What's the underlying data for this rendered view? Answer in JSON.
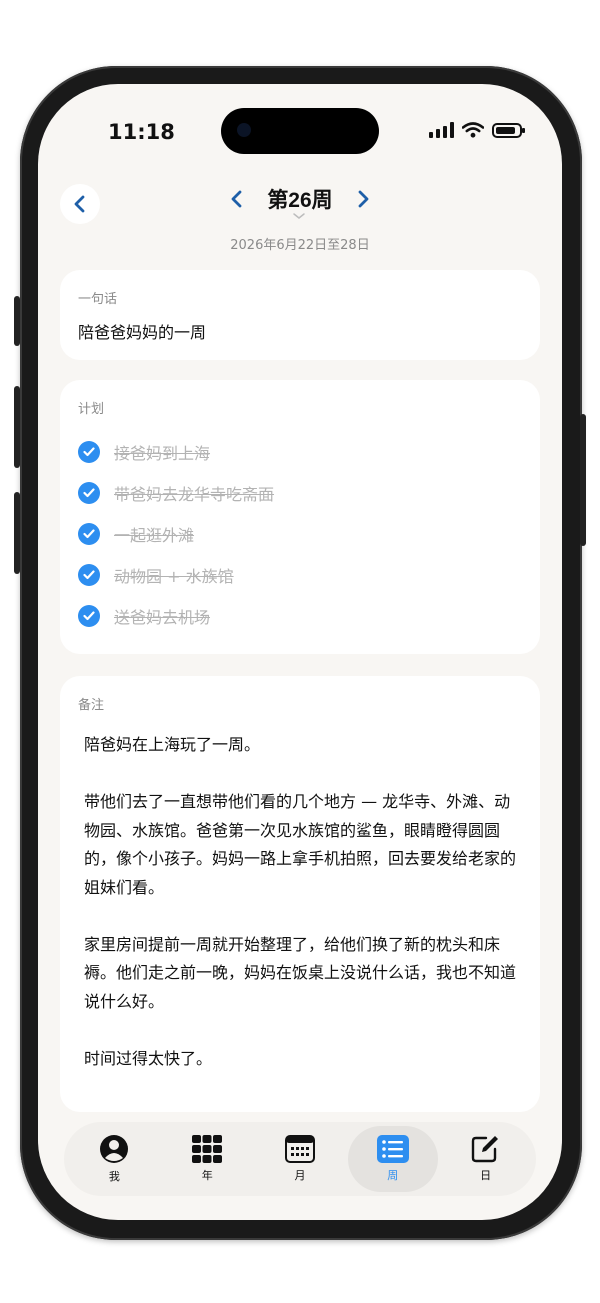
{
  "status": {
    "time": "11:18"
  },
  "header": {
    "week_title": "第26周",
    "date_range": "2026年6月22日至28日"
  },
  "sentence_card": {
    "label": "一句话",
    "text": "陪爸爸妈妈的一周"
  },
  "plan_card": {
    "label": "计划",
    "items": [
      {
        "text": "接爸妈到上海",
        "done": true
      },
      {
        "text": "带爸妈去龙华寺吃斋面",
        "done": true
      },
      {
        "text": "一起逛外滩",
        "done": true
      },
      {
        "text": "动物园 + 水族馆",
        "done": true
      },
      {
        "text": "送爸妈去机场",
        "done": true
      }
    ]
  },
  "notes_card": {
    "label": "备注",
    "paragraphs": [
      "陪爸妈在上海玩了一周。",
      "带他们去了一直想带他们看的几个地方 — 龙华寺、外滩、动物园、水族馆。爸爸第一次见水族馆的鲨鱼，眼睛瞪得圆圆的，像个小孩子。妈妈一路上拿手机拍照，回去要发给老家的姐妹们看。",
      "家里房间提前一周就开始整理了，给他们换了新的枕头和床褥。他们走之前一晚，妈妈在饭桌上没说什么话，我也不知道说什么好。",
      "时间过得太快了。"
    ]
  },
  "tabbar": {
    "tabs": [
      {
        "label": "我",
        "icon": "person-icon"
      },
      {
        "label": "年",
        "icon": "grid-icon"
      },
      {
        "label": "月",
        "icon": "calendar-icon"
      },
      {
        "label": "周",
        "icon": "list-icon",
        "active": true
      },
      {
        "label": "日",
        "icon": "edit-icon"
      }
    ]
  },
  "colors": {
    "accent": "#2d8ef0",
    "nav_blue": "#1e5fa8",
    "background": "#f8f6f3"
  },
  "battery_level": 0.85
}
